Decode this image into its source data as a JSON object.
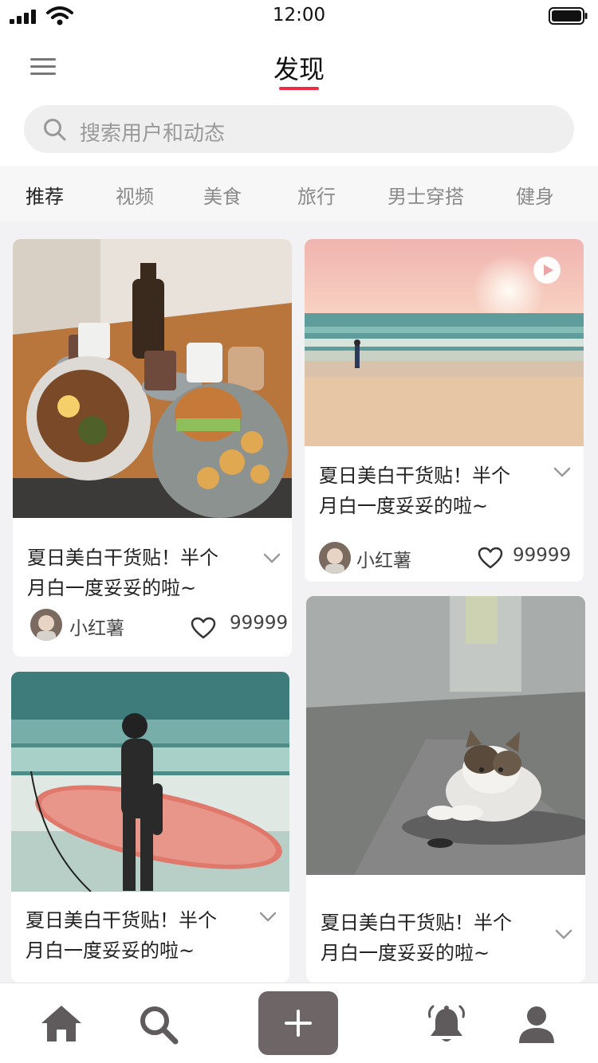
{
  "status_bar": {
    "time": "12:00"
  },
  "header": {
    "title": "发现",
    "search_placeholder": "搜索用户和动态"
  },
  "tabs": [
    {
      "label": "推荐",
      "active": true
    },
    {
      "label": "视频",
      "active": false
    },
    {
      "label": "美食",
      "active": false
    },
    {
      "label": "旅行",
      "active": false
    },
    {
      "label": "男士穿搭",
      "active": false
    },
    {
      "label": "健身",
      "active": false
    }
  ],
  "feed": {
    "cards": [
      {
        "image": "food-table-photo",
        "title_line1": "夏日美白干货贴！半个",
        "title_line2": "月白一度妥妥的啦~",
        "author": "小红薯",
        "likes": "99999"
      },
      {
        "image": "beach-sunset-video",
        "has_video": true,
        "title_line1": "夏日美白干货贴！半个",
        "title_line2": "月白一度妥妥的啦~",
        "author": "小红薯",
        "likes": "99999"
      },
      {
        "image": "surfer-photo",
        "title_line1": "夏日美白干货贴！半个",
        "title_line2": "月白一度妥妥的啦~"
      },
      {
        "image": "cat-photo",
        "title_line1": "夏日美白干货贴！半个",
        "title_line2": "月白一度妥妥的啦~"
      }
    ]
  },
  "colors": {
    "accent": "#ee2b47",
    "add_button": "#6e6566",
    "nav_icon": "#5f5a5b"
  },
  "bottom_nav": [
    "home-icon",
    "search-icon",
    "add-button",
    "bell-icon",
    "profile-icon"
  ]
}
